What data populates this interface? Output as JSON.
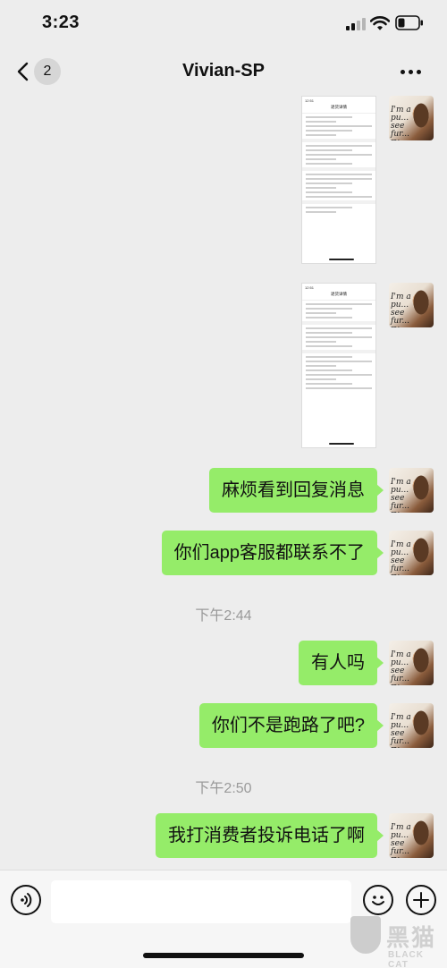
{
  "status_bar": {
    "time": "3:23"
  },
  "nav": {
    "unread_count": "2",
    "title": "Vivian-SP"
  },
  "avatar_text": "I'm a pu... see fur... ry",
  "thumbnails": [
    {
      "status_time": "12:51",
      "header": "退货详情"
    },
    {
      "status_time": "12:51",
      "header": "退货详情"
    }
  ],
  "messages": [
    {
      "text": "麻烦看到回复消息"
    },
    {
      "text": "你们app客服都联系不了"
    },
    {
      "text": "有人吗"
    },
    {
      "text": "你们不是跑路了吧?"
    },
    {
      "text": "我打消费者投诉电话了啊"
    }
  ],
  "timestamps": [
    "下午2:44",
    "下午2:50"
  ],
  "input": {
    "value": "",
    "placeholder": ""
  },
  "watermark": {
    "cn": "黑猫",
    "en": "BLACK CAT"
  },
  "colors": {
    "background": "#ededed",
    "bubble": "#95ec69",
    "timestamp": "#9a9a9a"
  }
}
